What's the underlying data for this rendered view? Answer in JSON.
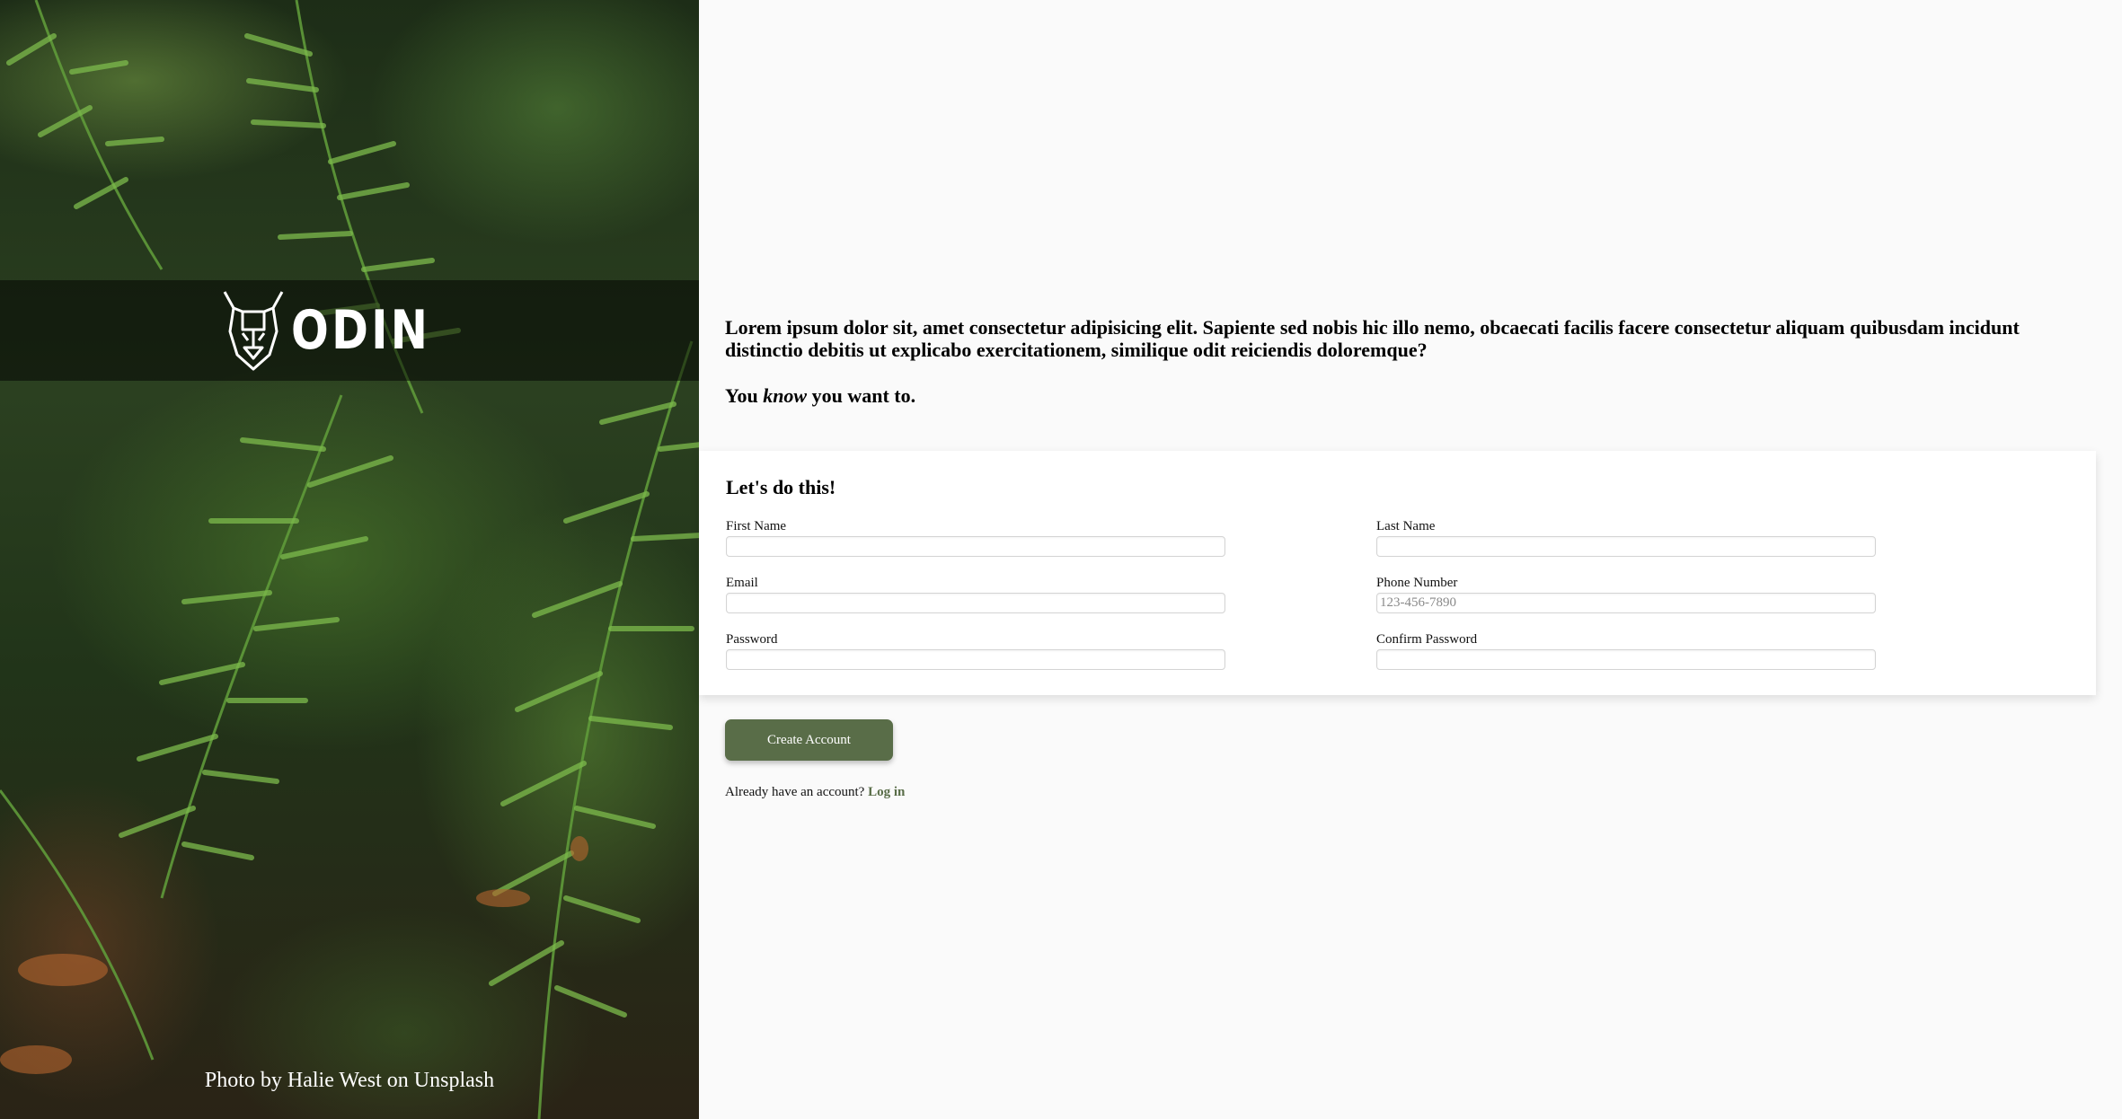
{
  "brand": {
    "logo_text": "ODIN",
    "logo_icon": "viking-helmet-icon"
  },
  "sidebar": {
    "photo_credit": "Photo by Halie West on Unsplash"
  },
  "intro": {
    "text": "Lorem ipsum dolor sit, amet consectetur adipisicing elit. Sapiente sed nobis hic illo nemo, obcaecati facilis facere consectetur aliquam quibusdam incidunt distinctio debitis ut explicabo exercitationem, similique odit reiciendis doloremque?",
    "tagline_before": "You ",
    "tagline_em": "know",
    "tagline_after": " you want to."
  },
  "form": {
    "title": "Let's do this!",
    "fields": {
      "first_name": {
        "label": "First Name",
        "value": "",
        "placeholder": ""
      },
      "last_name": {
        "label": "Last Name",
        "value": "",
        "placeholder": ""
      },
      "email": {
        "label": "Email",
        "value": "",
        "placeholder": ""
      },
      "phone": {
        "label": "Phone Number",
        "value": "",
        "placeholder": "123-456-7890"
      },
      "password": {
        "label": "Password",
        "value": "",
        "placeholder": ""
      },
      "confirm_password": {
        "label": "Confirm Password",
        "value": "",
        "placeholder": ""
      }
    }
  },
  "actions": {
    "create_label": "Create Account",
    "login_prompt": "Already have an account? ",
    "login_link": "Log in"
  },
  "colors": {
    "accent": "#596d48",
    "page_background": "#fafafa",
    "card_background": "#ffffff"
  }
}
